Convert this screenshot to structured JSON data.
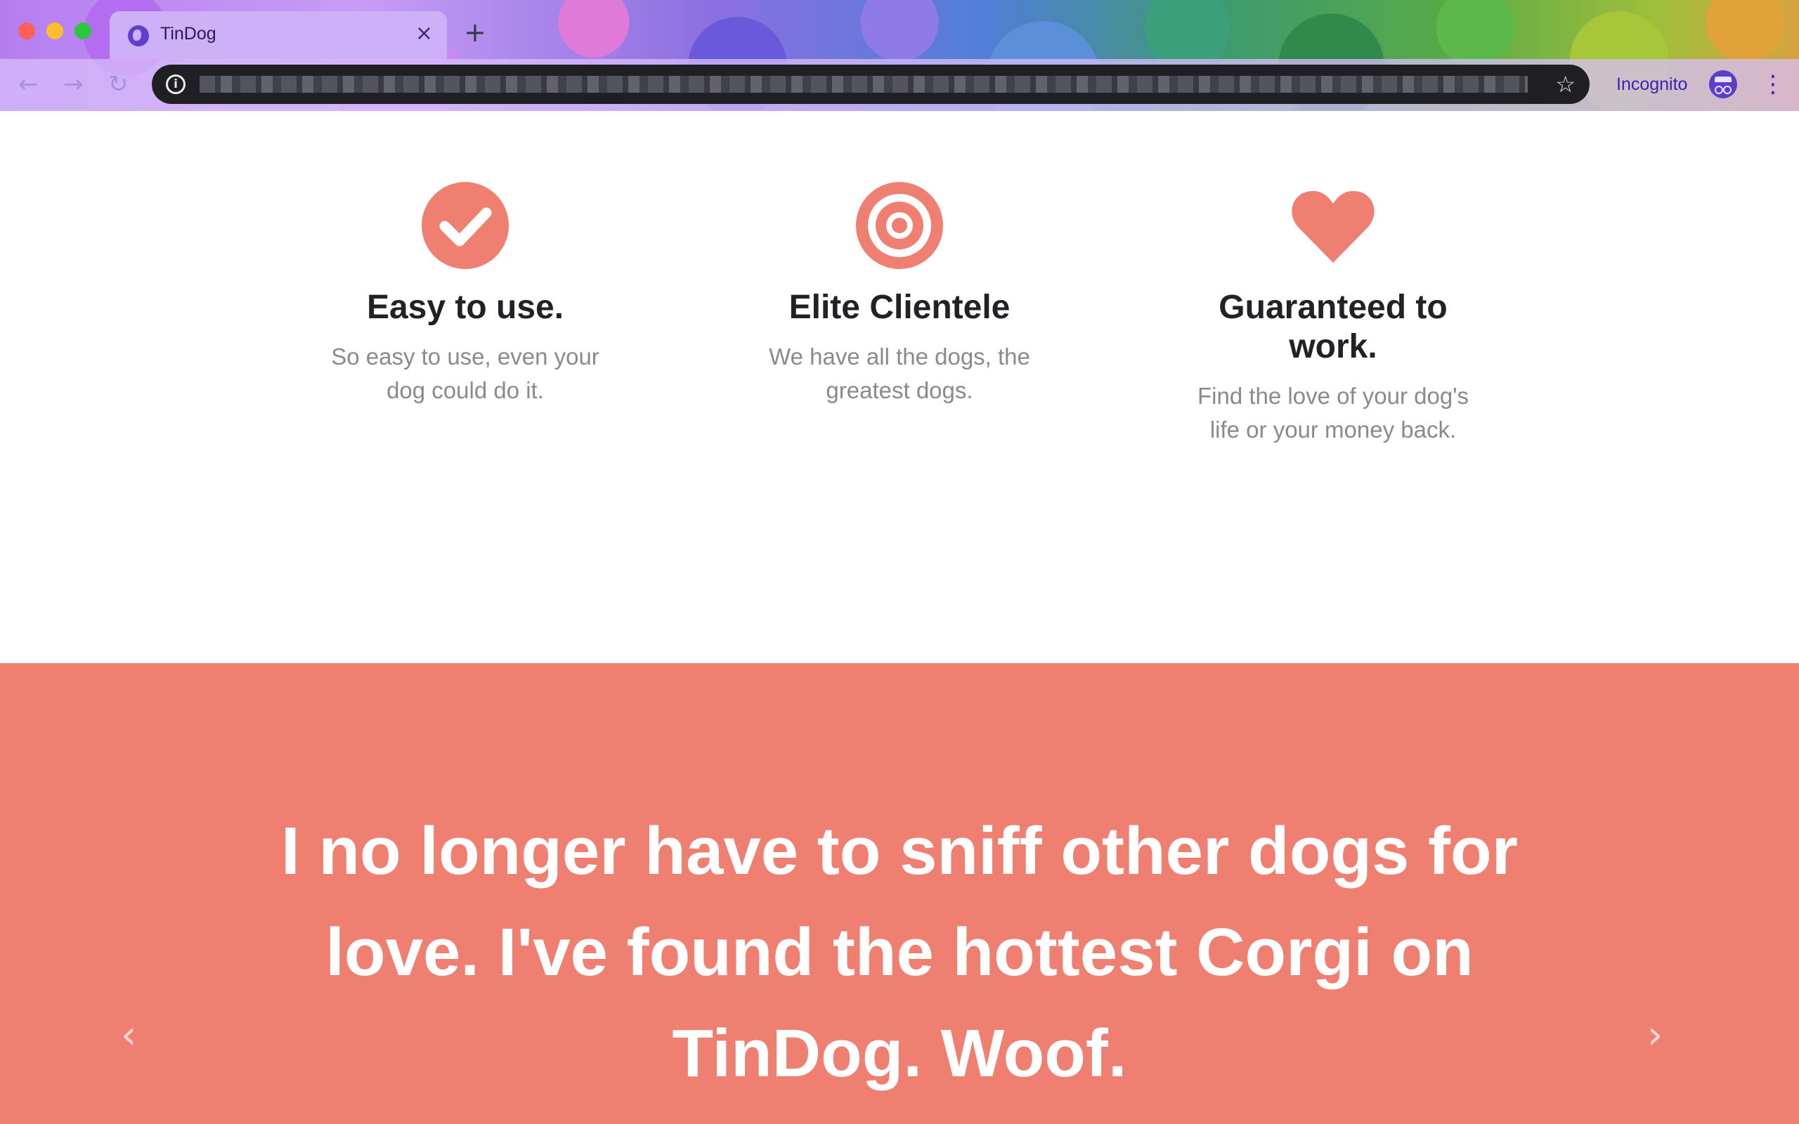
{
  "browser": {
    "tab_title": "TinDog",
    "tab_close": "×",
    "new_tab": "+",
    "back": "←",
    "forward": "→",
    "reload": "↻",
    "info": "i",
    "star": "☆",
    "incognito_label": "Incognito",
    "menu": "⋮"
  },
  "features": [
    {
      "icon": "check-circle-icon",
      "title": "Easy to use.",
      "description": "So easy to use, even your dog could do it."
    },
    {
      "icon": "bullseye-icon",
      "title": "Elite Clientele",
      "description": "We have all the dogs, the greatest dogs."
    },
    {
      "icon": "heart-icon",
      "title": "Guaranteed to work.",
      "description": "Find the love of your dog's life or your money back."
    }
  ],
  "testimonial": {
    "quote": "I no longer have to sniff other dogs for love. I've found the hottest Corgi on TinDog. Woof.",
    "prev": "‹",
    "next": "›"
  },
  "colors": {
    "accent": "#ef7f70",
    "heading": "#222226",
    "muted": "#8a8a8e",
    "incognito": "#3b23b3"
  }
}
